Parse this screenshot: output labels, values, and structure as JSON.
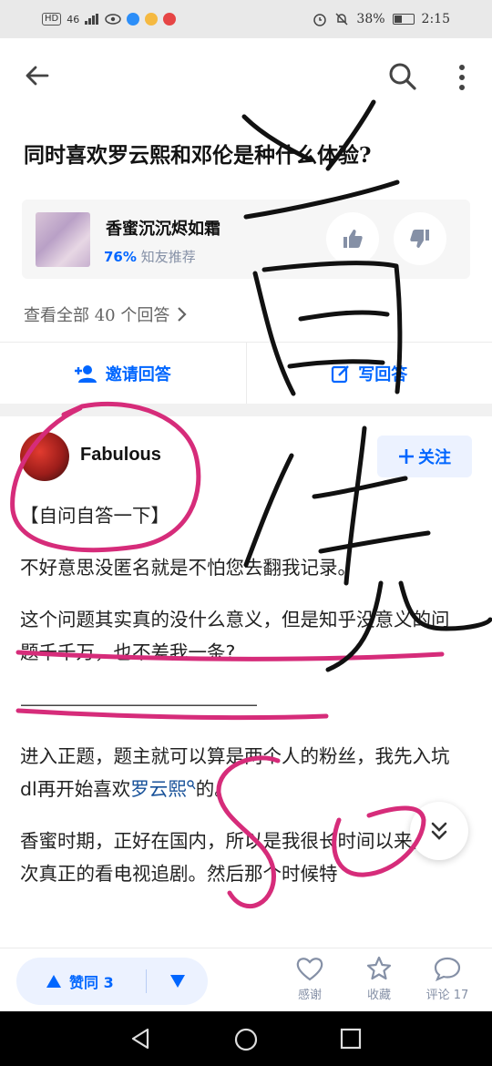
{
  "status": {
    "chip": "HD",
    "network": "46",
    "battery": "38%",
    "time": "2:15"
  },
  "top_bar": {
    "back_icon": "back-arrow-icon",
    "search_icon": "search-icon",
    "more_icon": "more-vertical-icon"
  },
  "question": {
    "title": "同时喜欢罗云熙和邓伦是种什么体验?"
  },
  "promo": {
    "title": "香蜜沉沉烬如霜",
    "percent": "76%",
    "subtitle": "知友推荐"
  },
  "answers_link": {
    "label": "查看全部 40 个回答"
  },
  "actions": {
    "invite_label": "邀请回答",
    "write_label": "写回答"
  },
  "author": {
    "name": "Fabulous",
    "follow_label": "关注"
  },
  "answer": {
    "p1": "【自问自答一下】",
    "p2": "不好意思没匿名就是不怕您去翻我记录。",
    "p3": "这个问题其实真的没什么意义，但是知乎没意义的问题千千万，也不差我一条?",
    "p4": "——————————————",
    "p5_before": "进入正题，题主就可以算是两个人的粉丝，我先入坑dl再开始喜欢",
    "p5_link": "罗云熙",
    "p5_after": "的。",
    "p6": "香蜜时期，正好在国内，所以是我很长时间以来第一次真正的看电视追剧。然后那个时候特"
  },
  "bottom": {
    "agree_label": "赞同 3",
    "thanks_label": "感谢",
    "collect_label": "收藏",
    "comment_label": "评论 17"
  },
  "colors": {
    "accent": "#0066ff",
    "scribble_pink": "#d62c7a",
    "scribble_black": "#111111"
  }
}
